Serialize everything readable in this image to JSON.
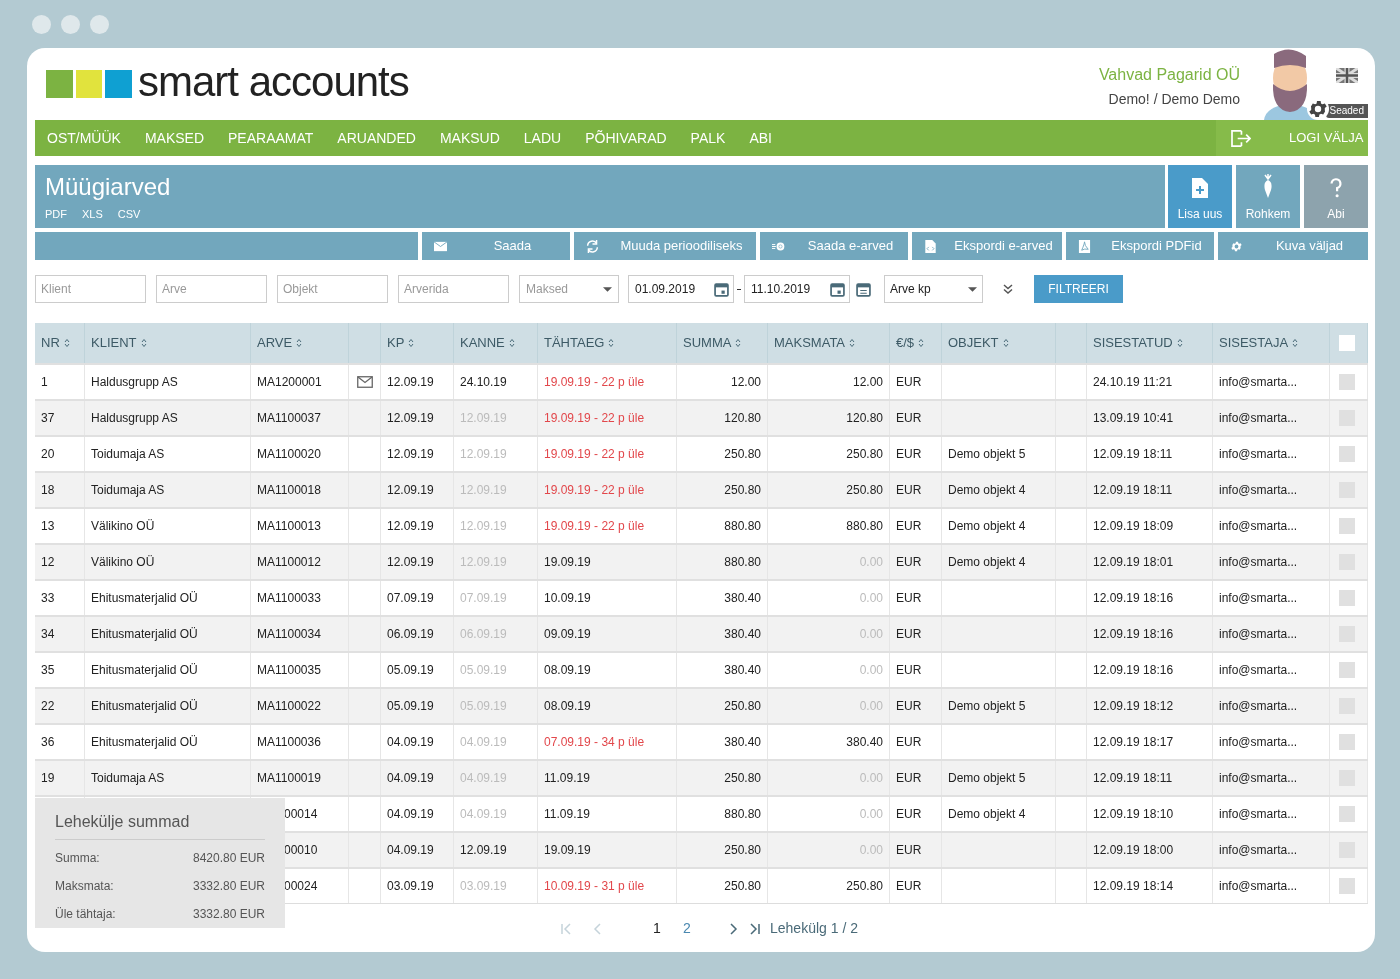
{
  "logo": {
    "text": "smart accounts"
  },
  "account": {
    "company": "Vahvad Pagarid OÜ",
    "user": "Demo! / Demo Demo",
    "settings_label": "Seaded"
  },
  "nav": {
    "items": [
      {
        "label": "OST/MÜÜK"
      },
      {
        "label": "MAKSED"
      },
      {
        "label": "PEARAAMAT"
      },
      {
        "label": "ARUANDED"
      },
      {
        "label": "MAKSUD"
      },
      {
        "label": "LADU"
      },
      {
        "label": "PÕHIVARAD"
      },
      {
        "label": "PALK"
      },
      {
        "label": "ABI"
      }
    ],
    "logout": "LOGI VÄLJA"
  },
  "page": {
    "title": "Müügiarved",
    "exports": [
      "PDF",
      "XLS",
      "CSV"
    ],
    "actions": [
      {
        "kind": "add",
        "label": "Lisa uus"
      },
      {
        "kind": "more",
        "label": "Rohkem"
      },
      {
        "kind": "help",
        "label": "Abi"
      }
    ]
  },
  "toolbar": [
    {
      "kind": "mail",
      "label": "Saada"
    },
    {
      "kind": "repeat",
      "label": "Muuda perioodiliseks"
    },
    {
      "kind": "send",
      "label": "Saada e-arved"
    },
    {
      "kind": "file",
      "label": "Ekspordi e-arved"
    },
    {
      "kind": "pdf",
      "label": "Ekspordi PDFid"
    },
    {
      "kind": "gear",
      "label": "Kuva väljad"
    }
  ],
  "filters": {
    "fields": [
      {
        "kind": "text",
        "placeholder": "Klient"
      },
      {
        "kind": "text",
        "placeholder": "Arve"
      },
      {
        "kind": "text",
        "placeholder": "Objekt"
      },
      {
        "kind": "text",
        "placeholder": "Arverida"
      },
      {
        "kind": "select",
        "placeholder": "Maksed"
      }
    ],
    "date_from": "01.09.2019",
    "date_to": "11.10.2019",
    "date_type": "Arve kp",
    "button": "FILTREERI"
  },
  "table": {
    "columns": [
      "NR",
      "KLIENT",
      "ARVE",
      "KP",
      "KANNE",
      "TÄHTAEG",
      "SUMMA",
      "MAKSMATA",
      "€/$",
      "OBJEKT",
      "SISESTATUD",
      "SISESTAJA"
    ],
    "select_all": {
      "checked": false
    },
    "rows": [
      {
        "nr": "1",
        "klient": "Haldusgrupp AS",
        "arve": "MA1200001",
        "emailed": true,
        "kp": "12.09.19",
        "kanne": "24.10.19",
        "kanne_pending": false,
        "tahtaeg": "19.09.19 - 22 p üle",
        "overdue": true,
        "summa": "12.00",
        "maksmata": "12.00",
        "paid": false,
        "valuuta": "EUR",
        "sisestatud": "24.10.19 11:21",
        "sisestaja": "info@smarta...",
        "checked": false
      },
      {
        "nr": "37",
        "klient": "Haldusgrupp AS",
        "arve": "MA1100037",
        "emailed": false,
        "kp": "12.09.19",
        "kanne": "12.09.19",
        "kanne_pending": true,
        "tahtaeg": "19.09.19 - 22 p üle",
        "overdue": true,
        "summa": "120.80",
        "maksmata": "120.80",
        "paid": false,
        "valuuta": "EUR",
        "sisestatud": "13.09.19 10:41",
        "sisestaja": "info@smarta...",
        "checked": false
      },
      {
        "nr": "20",
        "klient": "Toidumaja AS",
        "arve": "MA1100020",
        "emailed": false,
        "kp": "12.09.19",
        "kanne": "12.09.19",
        "kanne_pending": true,
        "tahtaeg": "19.09.19 - 22 p üle",
        "overdue": true,
        "summa": "250.80",
        "maksmata": "250.80",
        "paid": false,
        "valuuta": "EUR",
        "objekt": "Demo objekt 5",
        "sisestatud": "12.09.19 18:11",
        "sisestaja": "info@smarta...",
        "checked": false
      },
      {
        "nr": "18",
        "klient": "Toidumaja AS",
        "arve": "MA1100018",
        "emailed": false,
        "kp": "12.09.19",
        "kanne": "12.09.19",
        "kanne_pending": true,
        "tahtaeg": "19.09.19 - 22 p üle",
        "overdue": true,
        "summa": "250.80",
        "maksmata": "250.80",
        "paid": false,
        "valuuta": "EUR",
        "objekt": "Demo objekt 4",
        "sisestatud": "12.09.19 18:11",
        "sisestaja": "info@smarta...",
        "checked": false
      },
      {
        "nr": "13",
        "klient": "Välikino OÜ",
        "arve": "MA1100013",
        "emailed": false,
        "kp": "12.09.19",
        "kanne": "12.09.19",
        "kanne_pending": true,
        "tahtaeg": "19.09.19 - 22 p üle",
        "overdue": true,
        "summa": "880.80",
        "maksmata": "880.80",
        "paid": false,
        "valuuta": "EUR",
        "objekt": "Demo objekt 4",
        "sisestatud": "12.09.19 18:09",
        "sisestaja": "info@smarta...",
        "checked": false
      },
      {
        "nr": "12",
        "klient": "Välikino OÜ",
        "arve": "MA1100012",
        "emailed": false,
        "kp": "12.09.19",
        "kanne": "12.09.19",
        "kanne_pending": true,
        "tahtaeg": "19.09.19",
        "overdue": false,
        "summa": "880.80",
        "maksmata": "0.00",
        "paid": true,
        "valuuta": "EUR",
        "objekt": "Demo objekt 4",
        "sisestatud": "12.09.19 18:01",
        "sisestaja": "info@smarta...",
        "checked": false
      },
      {
        "nr": "33",
        "klient": "Ehitusmaterjalid OÜ",
        "arve": "MA1100033",
        "emailed": false,
        "kp": "07.09.19",
        "kanne": "07.09.19",
        "kanne_pending": true,
        "tahtaeg": "10.09.19",
        "overdue": false,
        "summa": "380.40",
        "maksmata": "0.00",
        "paid": true,
        "valuuta": "EUR",
        "sisestatud": "12.09.19 18:16",
        "sisestaja": "info@smarta...",
        "checked": false
      },
      {
        "nr": "34",
        "klient": "Ehitusmaterjalid OÜ",
        "arve": "MA1100034",
        "emailed": false,
        "kp": "06.09.19",
        "kanne": "06.09.19",
        "kanne_pending": true,
        "tahtaeg": "09.09.19",
        "overdue": false,
        "summa": "380.40",
        "maksmata": "0.00",
        "paid": true,
        "valuuta": "EUR",
        "sisestatud": "12.09.19 18:16",
        "sisestaja": "info@smarta...",
        "checked": false
      },
      {
        "nr": "35",
        "klient": "Ehitusmaterjalid OÜ",
        "arve": "MA1100035",
        "emailed": false,
        "kp": "05.09.19",
        "kanne": "05.09.19",
        "kanne_pending": true,
        "tahtaeg": "08.09.19",
        "overdue": false,
        "summa": "380.40",
        "maksmata": "0.00",
        "paid": true,
        "valuuta": "EUR",
        "sisestatud": "12.09.19 18:16",
        "sisestaja": "info@smarta...",
        "checked": false
      },
      {
        "nr": "22",
        "klient": "Ehitusmaterjalid OÜ",
        "arve": "MA1100022",
        "emailed": false,
        "kp": "05.09.19",
        "kanne": "05.09.19",
        "kanne_pending": true,
        "tahtaeg": "08.09.19",
        "overdue": false,
        "summa": "250.80",
        "maksmata": "0.00",
        "paid": true,
        "valuuta": "EUR",
        "objekt": "Demo objekt 5",
        "sisestatud": "12.09.19 18:12",
        "sisestaja": "info@smarta...",
        "checked": false
      },
      {
        "nr": "36",
        "klient": "Ehitusmaterjalid OÜ",
        "arve": "MA1100036",
        "emailed": false,
        "kp": "04.09.19",
        "kanne": "04.09.19",
        "kanne_pending": true,
        "tahtaeg": "07.09.19 - 34 p üle",
        "overdue": true,
        "summa": "380.40",
        "maksmata": "380.40",
        "paid": false,
        "valuuta": "EUR",
        "sisestatud": "12.09.19 18:17",
        "sisestaja": "info@smarta...",
        "checked": false
      },
      {
        "nr": "19",
        "klient": "Toidumaja AS",
        "arve": "MA1100019",
        "emailed": false,
        "kp": "04.09.19",
        "kanne": "04.09.19",
        "kanne_pending": true,
        "tahtaeg": "11.09.19",
        "overdue": false,
        "summa": "250.80",
        "maksmata": "0.00",
        "paid": true,
        "valuuta": "EUR",
        "objekt": "Demo objekt 5",
        "sisestatud": "12.09.19 18:11",
        "sisestaja": "info@smarta...",
        "checked": false
      },
      {
        "arve": "00014",
        "emailed": false,
        "kp": "04.09.19",
        "kanne": "04.09.19",
        "kanne_pending": true,
        "tahtaeg": "11.09.19",
        "overdue": false,
        "summa": "880.80",
        "maksmata": "0.00",
        "paid": true,
        "valuuta": "EUR",
        "objekt": "Demo objekt 4",
        "sisestatud": "12.09.19 18:10",
        "sisestaja": "info@smarta...",
        "checked": false
      },
      {
        "arve": "00010",
        "emailed": false,
        "kp": "04.09.19",
        "kanne": "12.09.19",
        "kanne_pending": false,
        "tahtaeg": "19.09.19",
        "overdue": false,
        "summa": "250.80",
        "maksmata": "0.00",
        "paid": true,
        "valuuta": "EUR",
        "sisestatud": "12.09.19 18:00",
        "sisestaja": "info@smarta...",
        "checked": false
      },
      {
        "arve": "00024",
        "emailed": false,
        "kp": "03.09.19",
        "kanne": "03.09.19",
        "kanne_pending": true,
        "tahtaeg": "10.09.19 - 31 p üle",
        "overdue": true,
        "summa": "250.80",
        "maksmata": "250.80",
        "paid": false,
        "valuuta": "EUR",
        "sisestatud": "12.09.19 18:14",
        "sisestaja": "info@smarta...",
        "checked": false
      }
    ]
  },
  "summary": {
    "title": "Lehekülje summad",
    "lines": [
      {
        "label": "Summa:",
        "value": "8420.80 EUR"
      },
      {
        "label": "Maksmata:",
        "value": "3332.80 EUR"
      },
      {
        "label": "Üle tähtaja:",
        "value": "3332.80 EUR"
      }
    ]
  },
  "pagination": {
    "pages": [
      {
        "label": "1",
        "selected": true
      },
      {
        "label": "2",
        "selected": false
      }
    ],
    "first_disabled": true,
    "prev_disabled": true,
    "next_disabled": false,
    "last_disabled": false,
    "info": "Lehekülg 1 / 2"
  }
}
